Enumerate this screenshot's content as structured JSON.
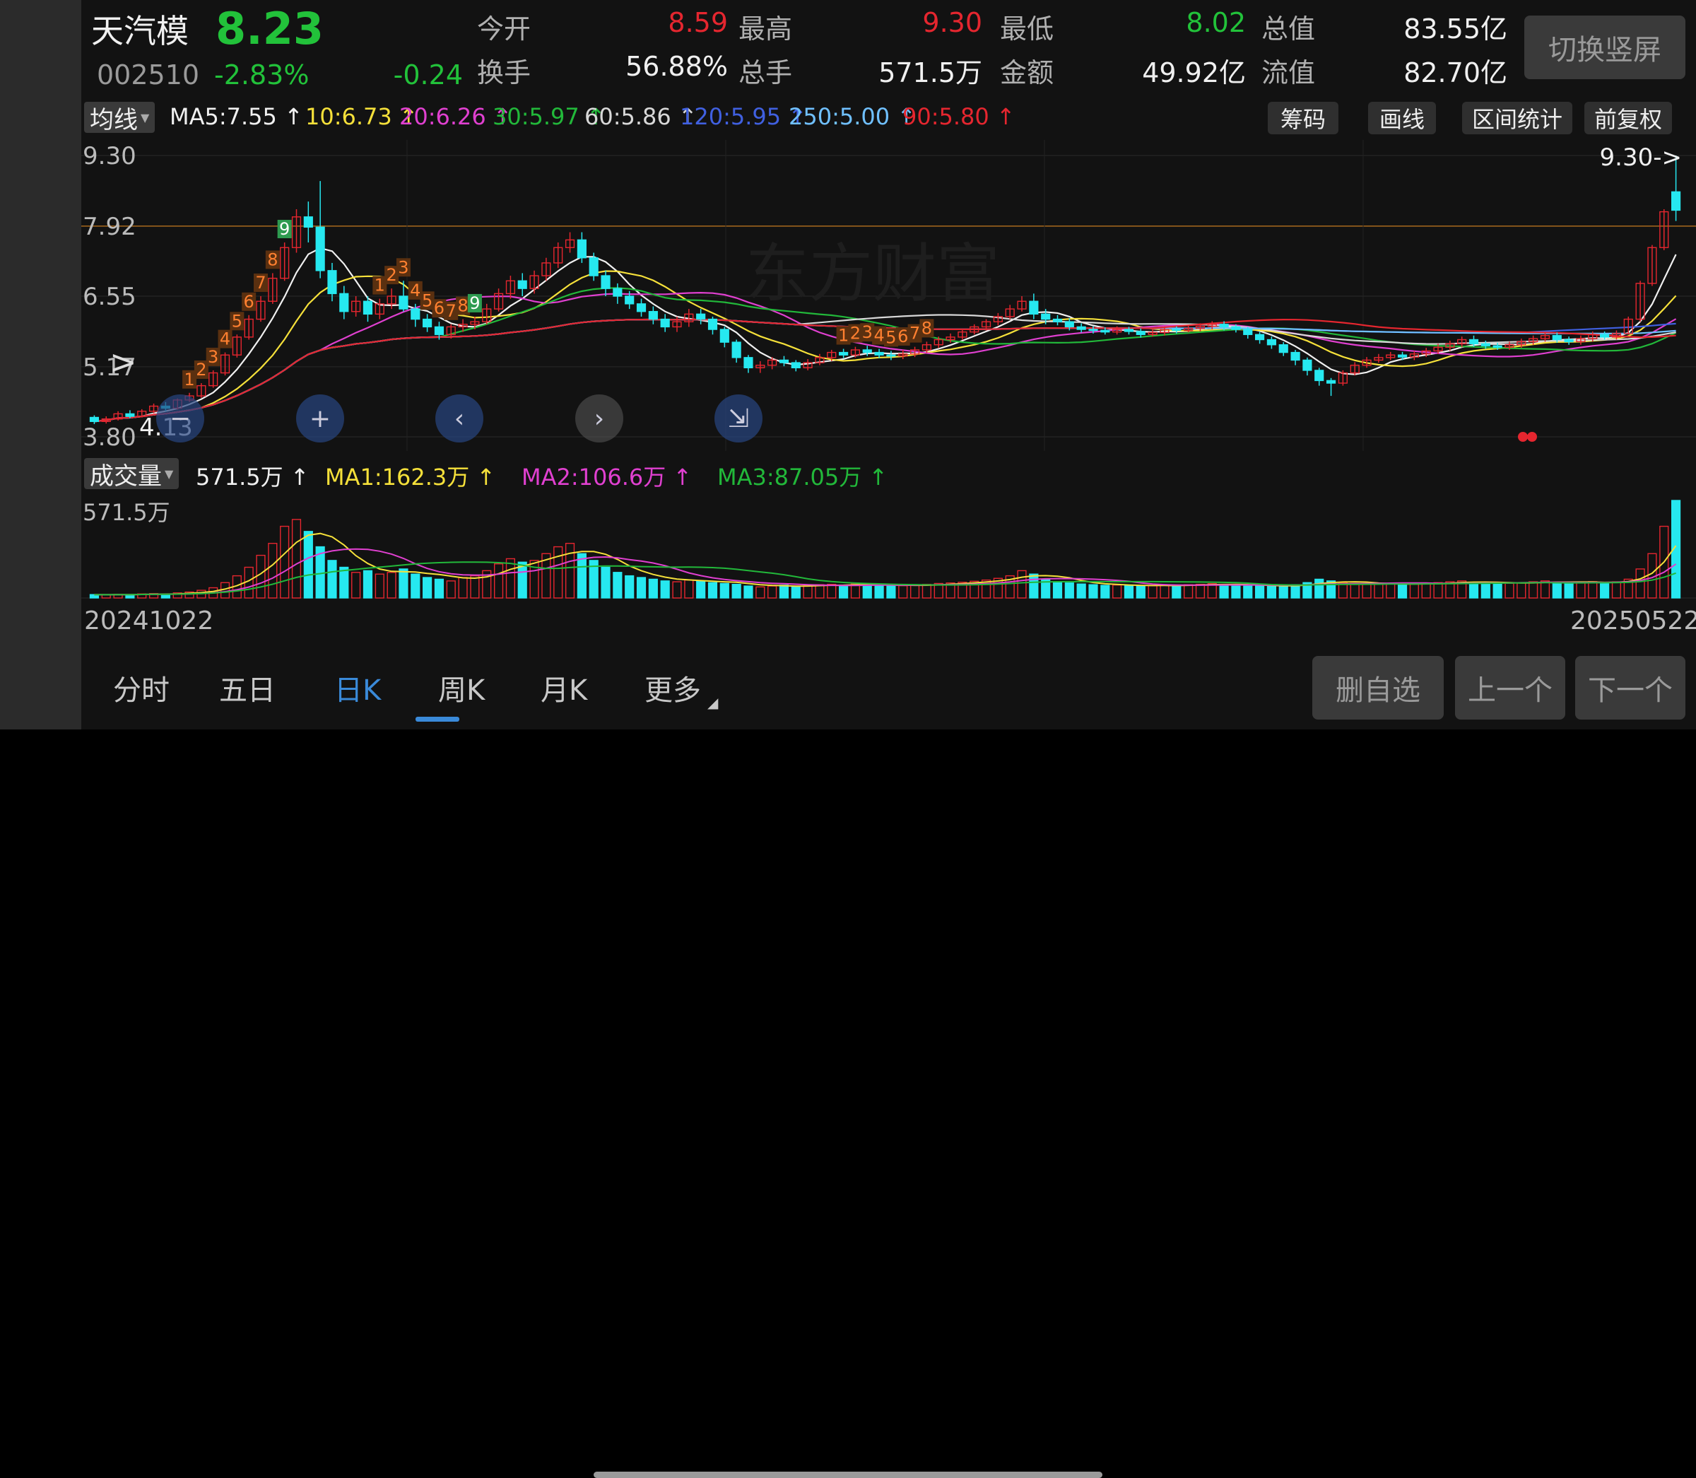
{
  "header": {
    "stock_name": "天汽模",
    "price": "8.23",
    "code": "002510",
    "change_pct": "-2.83%",
    "change_amt": "-0.24",
    "stats": [
      {
        "label": "今开",
        "value": "8.59",
        "color": "#e5262f"
      },
      {
        "label": "最高",
        "value": "9.30",
        "color": "#e5262f"
      },
      {
        "label": "最低",
        "value": "8.02",
        "color": "#22c23a"
      },
      {
        "label": "总值",
        "value": "83.55亿",
        "color": "#f0f0f0"
      },
      {
        "label": "换手",
        "value": "56.88%",
        "color": "#f0f0f0"
      },
      {
        "label": "总手",
        "value": "571.5万",
        "color": "#f0f0f0"
      },
      {
        "label": "金额",
        "value": "49.92亿",
        "color": "#f0f0f0"
      },
      {
        "label": "流值",
        "value": "82.70亿",
        "color": "#f0f0f0"
      }
    ],
    "switch_button": "切换竖屏"
  },
  "ma_bar": {
    "selector": "均线",
    "items": [
      {
        "text": "MA5:7.55 ↑",
        "color": "#f0f0f0"
      },
      {
        "text": "10:6.73 ↑",
        "color": "#f5e03a"
      },
      {
        "text": "20:6.26 ↑",
        "color": "#e040d0"
      },
      {
        "text": "30:5.97 ↑",
        "color": "#22b83a"
      },
      {
        "text": "60:5.86 ↑",
        "color": "#d8d8d8"
      },
      {
        "text": "120:5.95 ↑",
        "color": "#4060e0"
      },
      {
        "text": "250:5.00 ↑",
        "color": "#70c0ff"
      },
      {
        "text": "90:5.80 ↑",
        "color": "#e5262f"
      }
    ],
    "buttons": [
      "筹码",
      "画线",
      "区间统计",
      "前复权"
    ]
  },
  "price_chart": {
    "y_labels": [
      "9.30",
      "7.92",
      "6.55",
      "5.17",
      "3.80"
    ],
    "low_marker": "4.13",
    "high_marker": "9.30->",
    "watermark": "东方财富",
    "td9_counts": [
      "1",
      "2",
      "3",
      "4",
      "5",
      "6",
      "7",
      "8",
      "9"
    ],
    "controls": [
      "zoom-out-icon",
      "zoom-in-icon",
      "scroll-left-icon",
      "scroll-right-icon",
      "fit-icon"
    ]
  },
  "volume_bar": {
    "selector": "成交量",
    "items": [
      {
        "text": "571.5万 ↑",
        "color": "#f0f0f0"
      },
      {
        "text": "MA1:162.3万 ↑",
        "color": "#f5e03a"
      },
      {
        "text": "MA2:106.6万 ↑",
        "color": "#e040d0"
      },
      {
        "text": "MA3:87.05万 ↑",
        "color": "#22b83a"
      }
    ],
    "max_label": "571.5万"
  },
  "dates": {
    "start": "20241022",
    "end": "20250522"
  },
  "tabs": [
    "分时",
    "五日",
    "日K",
    "周K",
    "月K",
    "更多"
  ],
  "active_tab": "日K",
  "bottom_buttons": [
    "删自选",
    "上一个",
    "下一个"
  ],
  "chart_data": {
    "type": "candlestick",
    "y_range": [
      3.8,
      9.3
    ],
    "grid": true,
    "candles": [
      [
        4.18,
        4.1,
        4.22,
        4.05
      ],
      [
        4.1,
        4.15,
        4.2,
        4.06
      ],
      [
        4.15,
        4.25,
        4.3,
        4.12
      ],
      [
        4.25,
        4.2,
        4.32,
        4.16
      ],
      [
        4.2,
        4.3,
        4.34,
        4.18
      ],
      [
        4.3,
        4.4,
        4.45,
        4.26
      ],
      [
        4.4,
        4.36,
        4.48,
        4.3
      ],
      [
        4.36,
        4.52,
        4.55,
        4.33
      ],
      [
        4.52,
        4.6,
        4.66,
        4.48
      ],
      [
        4.6,
        4.8,
        4.85,
        4.56
      ],
      [
        4.8,
        5.05,
        5.1,
        4.76
      ],
      [
        5.05,
        5.4,
        5.45,
        5.0
      ],
      [
        5.4,
        5.75,
        5.8,
        5.35
      ],
      [
        5.75,
        6.1,
        6.18,
        5.7
      ],
      [
        6.1,
        6.45,
        6.55,
        6.05
      ],
      [
        6.45,
        6.9,
        7.0,
        6.4
      ],
      [
        6.9,
        7.5,
        7.6,
        6.85
      ],
      [
        7.5,
        8.1,
        8.25,
        7.4
      ],
      [
        8.1,
        7.9,
        8.4,
        7.6
      ],
      [
        7.9,
        7.05,
        8.8,
        6.9
      ],
      [
        7.05,
        6.6,
        7.2,
        6.45
      ],
      [
        6.6,
        6.25,
        6.75,
        6.1
      ],
      [
        6.25,
        6.45,
        6.55,
        6.15
      ],
      [
        6.45,
        6.2,
        6.55,
        6.05
      ],
      [
        6.2,
        6.4,
        6.5,
        6.1
      ],
      [
        6.4,
        6.55,
        6.7,
        6.3
      ],
      [
        6.55,
        6.3,
        6.85,
        6.25
      ],
      [
        6.3,
        6.1,
        6.4,
        5.95
      ],
      [
        6.1,
        5.95,
        6.2,
        5.85
      ],
      [
        5.95,
        5.8,
        6.05,
        5.7
      ],
      [
        5.8,
        5.95,
        6.0,
        5.72
      ],
      [
        5.95,
        6.0,
        6.1,
        5.85
      ],
      [
        6.0,
        6.05,
        6.15,
        5.9
      ],
      [
        6.05,
        6.3,
        6.4,
        6.0
      ],
      [
        6.3,
        6.6,
        6.7,
        6.25
      ],
      [
        6.6,
        6.85,
        6.95,
        6.5
      ],
      [
        6.85,
        6.7,
        7.0,
        6.55
      ],
      [
        6.7,
        6.95,
        7.05,
        6.6
      ],
      [
        6.95,
        7.2,
        7.3,
        6.85
      ],
      [
        7.2,
        7.5,
        7.6,
        7.1
      ],
      [
        7.5,
        7.65,
        7.8,
        7.4
      ],
      [
        7.65,
        7.3,
        7.8,
        7.2
      ],
      [
        7.3,
        6.95,
        7.4,
        6.85
      ],
      [
        6.95,
        6.7,
        7.05,
        6.55
      ],
      [
        6.7,
        6.55,
        6.8,
        6.4
      ],
      [
        6.55,
        6.4,
        6.65,
        6.3
      ],
      [
        6.4,
        6.25,
        6.5,
        6.15
      ],
      [
        6.25,
        6.1,
        6.35,
        6.0
      ],
      [
        6.1,
        5.95,
        6.2,
        5.85
      ],
      [
        5.95,
        6.05,
        6.15,
        5.85
      ],
      [
        6.05,
        6.2,
        6.3,
        5.95
      ],
      [
        6.2,
        6.1,
        6.3,
        6.0
      ],
      [
        6.1,
        5.9,
        6.15,
        5.8
      ],
      [
        5.9,
        5.65,
        5.95,
        5.55
      ],
      [
        5.65,
        5.35,
        5.7,
        5.25
      ],
      [
        5.35,
        5.15,
        5.4,
        5.05
      ],
      [
        5.15,
        5.2,
        5.28,
        5.05
      ],
      [
        5.2,
        5.3,
        5.36,
        5.12
      ],
      [
        5.3,
        5.25,
        5.38,
        5.18
      ],
      [
        5.25,
        5.15,
        5.3,
        5.08
      ],
      [
        5.15,
        5.25,
        5.32,
        5.1
      ],
      [
        5.25,
        5.35,
        5.42,
        5.2
      ],
      [
        5.35,
        5.45,
        5.5,
        5.28
      ],
      [
        5.45,
        5.4,
        5.52,
        5.34
      ],
      [
        5.4,
        5.5,
        5.56,
        5.35
      ],
      [
        5.5,
        5.45,
        5.58,
        5.38
      ],
      [
        5.45,
        5.4,
        5.52,
        5.34
      ],
      [
        5.4,
        5.38,
        5.48,
        5.3
      ],
      [
        5.38,
        5.42,
        5.5,
        5.32
      ],
      [
        5.42,
        5.5,
        5.56,
        5.36
      ],
      [
        5.5,
        5.6,
        5.66,
        5.44
      ],
      [
        5.6,
        5.7,
        5.76,
        5.54
      ],
      [
        5.7,
        5.75,
        5.82,
        5.64
      ],
      [
        5.75,
        5.85,
        5.9,
        5.7
      ],
      [
        5.85,
        5.95,
        6.0,
        5.8
      ],
      [
        5.95,
        6.05,
        6.1,
        5.88
      ],
      [
        6.05,
        6.15,
        6.22,
        5.98
      ],
      [
        6.15,
        6.3,
        6.38,
        6.1
      ],
      [
        6.3,
        6.45,
        6.55,
        6.25
      ],
      [
        6.45,
        6.2,
        6.6,
        6.1
      ],
      [
        6.2,
        6.1,
        6.3,
        6.0
      ],
      [
        6.1,
        6.05,
        6.18,
        5.98
      ],
      [
        6.05,
        5.95,
        6.12,
        5.88
      ],
      [
        5.95,
        5.9,
        6.02,
        5.84
      ],
      [
        5.9,
        5.88,
        5.96,
        5.82
      ],
      [
        5.88,
        5.85,
        5.94,
        5.8
      ],
      [
        5.85,
        5.9,
        5.96,
        5.8
      ],
      [
        5.9,
        5.86,
        5.95,
        5.8
      ],
      [
        5.86,
        5.8,
        5.92,
        5.74
      ],
      [
        5.8,
        5.84,
        5.9,
        5.76
      ],
      [
        5.84,
        5.9,
        5.96,
        5.78
      ],
      [
        5.9,
        5.88,
        5.96,
        5.82
      ],
      [
        5.88,
        5.92,
        5.98,
        5.84
      ],
      [
        5.92,
        5.96,
        6.02,
        5.86
      ],
      [
        5.96,
        6.0,
        6.06,
        5.9
      ],
      [
        6.0,
        5.95,
        6.06,
        5.88
      ],
      [
        5.95,
        5.9,
        6.0,
        5.84
      ],
      [
        5.9,
        5.8,
        5.95,
        5.72
      ],
      [
        5.8,
        5.7,
        5.85,
        5.62
      ],
      [
        5.7,
        5.6,
        5.76,
        5.52
      ],
      [
        5.6,
        5.45,
        5.65,
        5.38
      ],
      [
        5.45,
        5.3,
        5.5,
        5.2
      ],
      [
        5.3,
        5.1,
        5.35,
        5.0
      ],
      [
        5.1,
        4.9,
        5.15,
        4.8
      ],
      [
        4.9,
        4.85,
        4.95,
        4.6
      ],
      [
        4.85,
        5.05,
        5.1,
        4.8
      ],
      [
        5.05,
        5.2,
        5.26,
        5.0
      ],
      [
        5.2,
        5.3,
        5.36,
        5.15
      ],
      [
        5.3,
        5.35,
        5.42,
        5.25
      ],
      [
        5.35,
        5.4,
        5.46,
        5.3
      ],
      [
        5.4,
        5.36,
        5.46,
        5.3
      ],
      [
        5.36,
        5.42,
        5.48,
        5.3
      ],
      [
        5.42,
        5.48,
        5.54,
        5.36
      ],
      [
        5.48,
        5.55,
        5.62,
        5.42
      ],
      [
        5.55,
        5.62,
        5.68,
        5.48
      ],
      [
        5.62,
        5.7,
        5.76,
        5.55
      ],
      [
        5.7,
        5.62,
        5.78,
        5.56
      ],
      [
        5.62,
        5.58,
        5.68,
        5.52
      ],
      [
        5.58,
        5.55,
        5.64,
        5.5
      ],
      [
        5.55,
        5.6,
        5.66,
        5.5
      ],
      [
        5.6,
        5.66,
        5.72,
        5.54
      ],
      [
        5.66,
        5.72,
        5.78,
        5.6
      ],
      [
        5.72,
        5.78,
        5.84,
        5.66
      ],
      [
        5.78,
        5.7,
        5.84,
        5.64
      ],
      [
        5.7,
        5.66,
        5.76,
        5.6
      ],
      [
        5.66,
        5.72,
        5.78,
        5.6
      ],
      [
        5.72,
        5.8,
        5.86,
        5.66
      ],
      [
        5.8,
        5.75,
        5.86,
        5.7
      ],
      [
        5.75,
        5.82,
        5.88,
        5.7
      ],
      [
        5.82,
        6.1,
        6.15,
        5.8
      ],
      [
        6.1,
        6.8,
        6.85,
        6.05
      ],
      [
        6.8,
        7.5,
        7.55,
        6.75
      ],
      [
        7.5,
        8.2,
        8.25,
        7.45
      ],
      [
        8.59,
        8.23,
        9.3,
        8.02
      ]
    ],
    "volume_max": 571.5,
    "volumes": [
      20,
      18,
      22,
      19,
      24,
      26,
      22,
      30,
      35,
      45,
      60,
      90,
      130,
      180,
      250,
      320,
      420,
      460,
      390,
      300,
      220,
      180,
      150,
      160,
      140,
      150,
      170,
      140,
      120,
      110,
      100,
      120,
      130,
      160,
      200,
      230,
      210,
      220,
      260,
      300,
      320,
      260,
      220,
      180,
      150,
      130,
      120,
      110,
      100,
      95,
      105,
      100,
      90,
      85,
      80,
      70,
      65,
      70,
      75,
      68,
      72,
      78,
      80,
      76,
      82,
      78,
      74,
      70,
      72,
      76,
      80,
      85,
      88,
      92,
      98,
      105,
      115,
      130,
      160,
      140,
      110,
      95,
      88,
      82,
      78,
      74,
      76,
      72,
      70,
      72,
      76,
      74,
      78,
      80,
      84,
      80,
      76,
      72,
      70,
      68,
      72,
      78,
      90,
      110,
      100,
      90,
      85,
      80,
      82,
      84,
      80,
      82,
      86,
      90,
      95,
      100,
      92,
      88,
      84,
      86,
      90,
      95,
      100,
      92,
      88,
      92,
      96,
      90,
      94,
      110,
      170,
      260,
      420,
      571.5
    ]
  }
}
